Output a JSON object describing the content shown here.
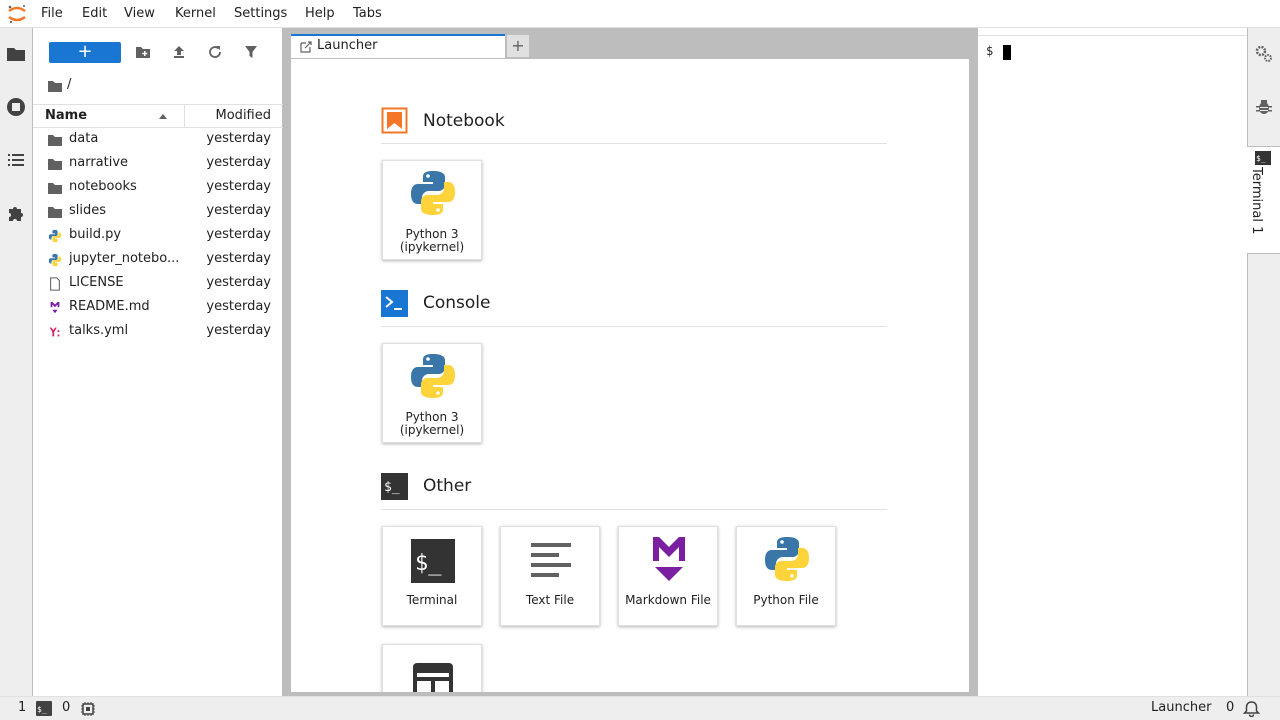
{
  "menu": {
    "items": [
      "File",
      "Edit",
      "View",
      "Kernel",
      "Settings",
      "Help",
      "Tabs"
    ]
  },
  "left_bar": {
    "icons": [
      "folder-icon",
      "running-icon",
      "toc-icon",
      "extension-icon"
    ]
  },
  "file_browser": {
    "new_button_label": "+",
    "breadcrumb": "/",
    "columns": {
      "name": "Name",
      "modified": "Modified"
    },
    "files": [
      {
        "name": "data",
        "modified": "yesterday",
        "type": "folder"
      },
      {
        "name": "narrative",
        "modified": "yesterday",
        "type": "folder"
      },
      {
        "name": "notebooks",
        "modified": "yesterday",
        "type": "folder"
      },
      {
        "name": "slides",
        "modified": "yesterday",
        "type": "folder"
      },
      {
        "name": "build.py",
        "modified": "yesterday",
        "type": "python"
      },
      {
        "name": "jupyter_notebo...",
        "modified": "yesterday",
        "type": "python"
      },
      {
        "name": "LICENSE",
        "modified": "yesterday",
        "type": "file"
      },
      {
        "name": "README.md",
        "modified": "yesterday",
        "type": "markdown"
      },
      {
        "name": "talks.yml",
        "modified": "yesterday",
        "type": "yaml"
      }
    ]
  },
  "tabs": {
    "launcher_label": "Launcher",
    "add_label": "+"
  },
  "launcher": {
    "sections": {
      "notebook": {
        "title": "Notebook",
        "cards": [
          {
            "label": "Python 3 (ipykernel)"
          }
        ]
      },
      "console": {
        "title": "Console",
        "cards": [
          {
            "label": "Python 3 (ipykernel)"
          }
        ]
      },
      "other": {
        "title": "Other",
        "cards": [
          {
            "label": "Terminal"
          },
          {
            "label": "Text File"
          },
          {
            "label": "Markdown File"
          },
          {
            "label": "Python File"
          },
          {
            "label": ""
          }
        ]
      }
    }
  },
  "terminal": {
    "prompt": "$",
    "tab_label": "Terminal 1"
  },
  "status_bar": {
    "terminals_count": "1",
    "kernels_count": "0",
    "current": "Launcher",
    "notifications": "0"
  },
  "colors": {
    "accent": "#1976d2",
    "notebook_orange": "#f37726",
    "markdown_purple": "#7b1fa2",
    "yaml_red": "#d81b60",
    "python_blue": "#3a76a8",
    "python_yellow": "#ffd43b"
  }
}
